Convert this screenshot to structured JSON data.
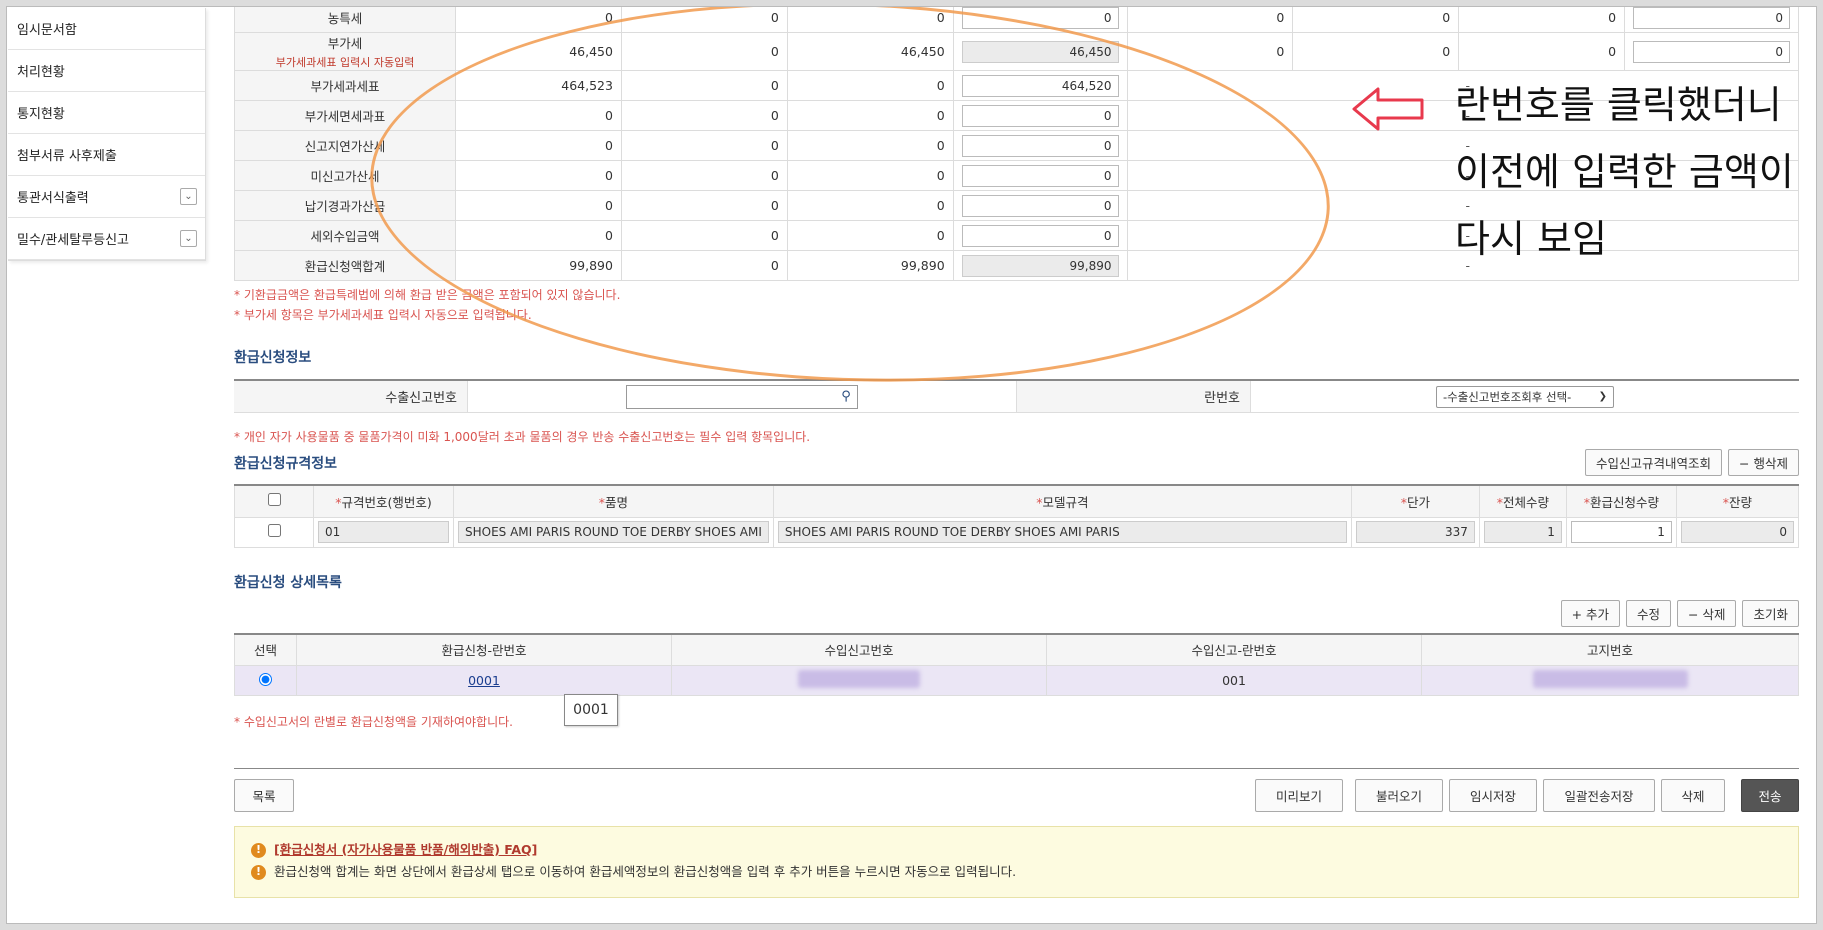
{
  "sidebar": {
    "items": [
      {
        "label": "임시문서함",
        "has_chevron": false
      },
      {
        "label": "처리현황",
        "has_chevron": false
      },
      {
        "label": "통지현황",
        "has_chevron": false
      },
      {
        "label": "첨부서류 사후제출",
        "has_chevron": false
      },
      {
        "label": "통관서식출력",
        "has_chevron": true
      },
      {
        "label": "밀수/관세탈루등신고",
        "has_chevron": true
      }
    ]
  },
  "amounts": {
    "rows": [
      {
        "label": "농특세",
        "sub": "",
        "c1": "0",
        "c2": "0",
        "c3": "0",
        "c4": "0",
        "c4_gray": false,
        "c5": "0",
        "c6": "0",
        "c7": "0",
        "c8": "0",
        "has_right": true
      },
      {
        "label": "부가세",
        "sub": "부가세과세표 입력시 자동입력",
        "c1": "46,450",
        "c2": "0",
        "c3": "46,450",
        "c4": "46,450",
        "c4_gray": true,
        "c5": "0",
        "c6": "0",
        "c7": "0",
        "c8": "0",
        "has_right": true
      },
      {
        "label": "부가세과세표",
        "sub": "",
        "c1": "464,523",
        "c2": "0",
        "c3": "0",
        "c4": "464,520",
        "c4_gray": false,
        "dash": "-",
        "has_right": false
      },
      {
        "label": "부가세면세과표",
        "sub": "",
        "c1": "0",
        "c2": "0",
        "c3": "0",
        "c4": "0",
        "c4_gray": false,
        "dash": "-",
        "has_right": false
      },
      {
        "label": "신고지연가산세",
        "sub": "",
        "c1": "0",
        "c2": "0",
        "c3": "0",
        "c4": "0",
        "c4_gray": false,
        "dash": "-",
        "has_right": false
      },
      {
        "label": "미신고가산세",
        "sub": "",
        "c1": "0",
        "c2": "0",
        "c3": "0",
        "c4": "0",
        "c4_gray": false,
        "dash": "-",
        "has_right": false
      },
      {
        "label": "납기경과가산금",
        "sub": "",
        "c1": "0",
        "c2": "0",
        "c3": "0",
        "c4": "0",
        "c4_gray": false,
        "dash": "-",
        "has_right": false
      },
      {
        "label": "세외수입금액",
        "sub": "",
        "c1": "0",
        "c2": "0",
        "c3": "0",
        "c4": "0",
        "c4_gray": false,
        "dash": "-",
        "has_right": false
      },
      {
        "label": "환급신청액합계",
        "sub": "",
        "c1": "99,890",
        "c2": "0",
        "c3": "99,890",
        "c4": "99,890",
        "c4_gray": true,
        "dash": "-",
        "has_right": false
      }
    ],
    "note1": "* 기환급금액은 환급특례법에 의해 환급 받은 금액은 포함되어 있지 않습니다.",
    "note2": "* 부가세 항목은 부가세과세표 입력시 자동으로 입력됩니다."
  },
  "refund_info": {
    "title": "환급신청정보",
    "export_label": "수출신고번호",
    "export_value": "",
    "line_label": "란번호",
    "line_select": "-수출신고번호조회후 선택-",
    "note": "* 개인 자가 사용물품 중 물품가격이 미화 1,000달러 초과 물품의 경우 반송 수출신고번호는 필수 입력 항목입니다."
  },
  "spec_info": {
    "title": "환급신청규격정보",
    "btn_lookup": "수입신고규격내역조회",
    "btn_delete_row": "− 행삭제",
    "headers": [
      "규격번호(행번호)",
      "품명",
      "모델규격",
      "단가",
      "전체수량",
      "환급신청수량",
      "잔량"
    ],
    "row": {
      "no": "01",
      "name": "SHOES AMI PARIS ROUND TOE DERBY SHOES    AMI",
      "model": "SHOES AMI PARIS ROUND TOE DERBY SHOES    AMI PARIS",
      "price": "337",
      "total_qty": "1",
      "refund_qty": "1",
      "remain": "0"
    }
  },
  "detail_list": {
    "title": "환급신청 상세목록",
    "btn_add": "+ 추가",
    "btn_edit": "수정",
    "btn_delete": "− 삭제",
    "btn_reset": "초기화",
    "headers": [
      "선택",
      "환급신청-란번호",
      "수입신고번호",
      "수입신고-란번호",
      "고지번호"
    ],
    "row": {
      "line_no": "0001",
      "import_line": "001"
    },
    "tooltip": "0001",
    "note": "* 수입신고서의 란별로 환급신청액을 기재하여야합니다."
  },
  "bottom_bar": {
    "list": "목록",
    "preview": "미리보기",
    "load": "불러오기",
    "temp_save": "임시저장",
    "batch_save": "일괄전송저장",
    "delete": "삭제",
    "send": "전송"
  },
  "faq": {
    "link": "[환급신청서 (자가사용물품 반품/해외반출) FAQ]",
    "text": "환급신청액 합계는 화면 상단에서 환급상세 탭으로 이동하여 환급세액정보의 환급신청액을 입력 후 추가 버튼을 누르시면 자동으로 입력됩니다."
  },
  "annotation": {
    "line1": "란번호를 클릭했더니",
    "line2": "이전에 입력한 금액이",
    "line3": "다시 보임",
    "oval_color": "#f19a4e",
    "arrow_color": "#e8394d"
  }
}
